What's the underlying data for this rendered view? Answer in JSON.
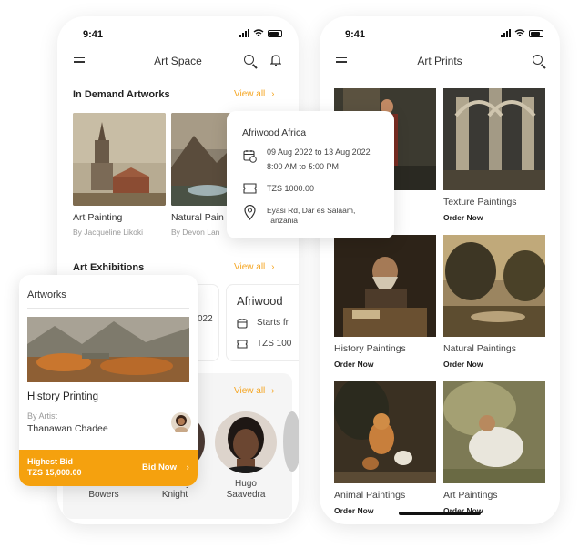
{
  "left_phone": {
    "time": "9:41",
    "title": "Art Space",
    "in_demand": {
      "title": "In Demand Artworks",
      "view_all": "View all",
      "items": [
        {
          "title": "Art Painting",
          "author": "By Jacqueline Likoki"
        },
        {
          "title": "Natural Pain",
          "author": "By Devon Lan"
        }
      ]
    },
    "exhibitions": {
      "title": "Art Exhibitions",
      "view_all": "View all",
      "card1_date": "022",
      "card2_title": "Afriwood",
      "card2_time": "Starts fr",
      "card2_price": "TZS 100"
    },
    "artists": {
      "view_all": "View all",
      "people": [
        {
          "first": "Donald",
          "last": "Bowers"
        },
        {
          "first": "Rodney",
          "last": "Knight"
        },
        {
          "first": "Hugo",
          "last": "Saavedra"
        }
      ]
    }
  },
  "event_popup": {
    "title": "Afriwood Africa",
    "date": "09 Aug 2022 to 13 Aug 2022",
    "time": "8:00 AM to 5:00 PM",
    "price": "TZS 1000.00",
    "address_line1": "Eyasi Rd, Dar es Salaam,",
    "address_line2": "Tanzania"
  },
  "artwork_card": {
    "header": "Artworks",
    "title": "History Printing",
    "by_label": "By Artist",
    "artist": "Thanawan Chadee",
    "bid_label": "Highest Bid",
    "bid_value": "TZS 15,000.00",
    "bid_button": "Bid Now"
  },
  "right_phone": {
    "time": "9:41",
    "title": "Art Prints",
    "items": [
      {
        "title": "ngs",
        "action": ""
      },
      {
        "title": "Texture Paintings",
        "action": "Order Now"
      },
      {
        "title": "History Paintings",
        "action": "Order Now"
      },
      {
        "title": "Natural Paintings",
        "action": "Order Now"
      },
      {
        "title": "Animal Paintings",
        "action": "Order Now"
      },
      {
        "title": "Art Paintings",
        "action": "Order Now"
      }
    ]
  },
  "colors": {
    "accent": "#f5a623",
    "bid_bar": "#f5a10e"
  },
  "icons": [
    "menu-icon",
    "search-icon",
    "bell-icon",
    "calendar-icon",
    "ticket-icon",
    "location-icon",
    "chevron-right-icon"
  ]
}
